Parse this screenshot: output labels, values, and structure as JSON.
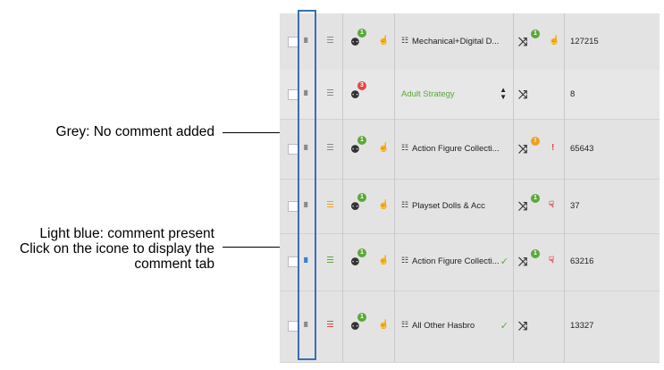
{
  "annotations": {
    "grey": "Grey: No comment added",
    "blue_line1": "Light blue: comment present",
    "blue_line2": "Click on the icone to display the",
    "blue_line3": "comment tab"
  },
  "colors": {
    "comment_grey": "#8a8a8a",
    "comment_blue": "#3a7fd0",
    "green": "#5aa83a",
    "red": "#e04848",
    "amber": "#f0a020",
    "highlight_box": "#3a6fb0"
  },
  "icons": {
    "comment": "comment-icon",
    "list": "list-icon",
    "robot": "robot-icon",
    "thumb_up": "thumbs-up-icon",
    "thumb_down": "thumbs-down-icon",
    "hierarchy": "hierarchy-icon",
    "shuffle": "shuffle-icon",
    "check": "check-icon",
    "exclamation": "exclamation-icon",
    "sort": "sort-icon"
  },
  "rows": [
    {
      "category": "Mechanical+Digital D...",
      "badge": "1",
      "badge_color": "green",
      "number": "127215",
      "shuffle_badge": "1",
      "shuffle_badge_color": "green",
      "status": "thumb-up",
      "list_color": "grey",
      "comment": "grey",
      "check": false,
      "strategy": false
    },
    {
      "category": "Adult Strategy",
      "badge": "3",
      "badge_color": "red",
      "number": "8",
      "shuffle_badge": "",
      "status": "none",
      "list_color": "grey",
      "comment": "grey",
      "check": false,
      "strategy": true
    },
    {
      "category": "Action Figure Collecti...",
      "badge": "1",
      "badge_color": "green",
      "number": "65643",
      "shuffle_badge": "!",
      "shuffle_badge_color": "amber",
      "status": "exclamation",
      "list_color": "grey",
      "comment": "grey",
      "check": false,
      "strategy": false
    },
    {
      "category": "Playset Dolls & Acc",
      "badge": "1",
      "badge_color": "green",
      "number": "37",
      "shuffle_badge": "1",
      "shuffle_badge_color": "green",
      "status": "thumb-down",
      "list_color": "amber",
      "comment": "grey",
      "check": false,
      "strategy": false
    },
    {
      "category": "Action Figure Collecti...",
      "badge": "1",
      "badge_color": "green",
      "number": "63216",
      "shuffle_badge": "1",
      "shuffle_badge_color": "green",
      "status": "thumb-down",
      "list_color": "green",
      "comment": "blue",
      "check": true,
      "strategy": false
    },
    {
      "category": "All Other Hasbro",
      "badge": "1",
      "badge_color": "green",
      "number": "13327",
      "shuffle_badge": "",
      "status": "none",
      "list_color": "red",
      "comment": "grey",
      "check": true,
      "strategy": false
    }
  ]
}
